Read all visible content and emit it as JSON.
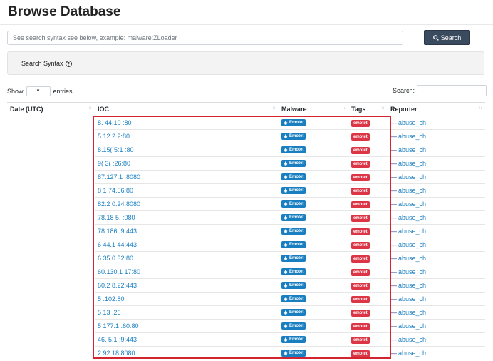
{
  "header": {
    "title": "Browse Database"
  },
  "search": {
    "placeholder": "See search syntax see below, example: malware:ZLoader",
    "button_label": "Search"
  },
  "syntax": {
    "label": "Search Syntax"
  },
  "length": {
    "show_label": "Show",
    "entries_label": "entries"
  },
  "filter": {
    "label": "Search:"
  },
  "table": {
    "columns": [
      "Date (UTC)",
      "IOC",
      "Malware",
      "Tags",
      "Reporter"
    ],
    "rows": [
      {
        "ioc": "8.  44.10     :80",
        "malware": "Emotet",
        "tag": "emotet",
        "reporter": "abuse_ch"
      },
      {
        "ioc": "5.12.2       2:80",
        "malware": "Emotet",
        "tag": "emotet",
        "reporter": "abuse_ch"
      },
      {
        "ioc": "8.15(      5:1  :80",
        "malware": "Emotet",
        "tag": "emotet",
        "reporter": "abuse_ch"
      },
      {
        "ioc": "9(     3(     :26:80",
        "malware": "Emotet",
        "tag": "emotet",
        "reporter": "abuse_ch"
      },
      {
        "ioc": "87.127.1      :8080",
        "malware": "Emotet",
        "tag": "emotet",
        "reporter": "abuse_ch"
      },
      {
        "ioc": "8   1      74.56:80",
        "malware": "Emotet",
        "tag": "emotet",
        "reporter": "abuse_ch"
      },
      {
        "ioc": "82.2       0.24:8080",
        "malware": "Emotet",
        "tag": "emotet",
        "reporter": "abuse_ch"
      },
      {
        "ioc": "78.18      5.   :080",
        "malware": "Emotet",
        "tag": "emotet",
        "reporter": "abuse_ch"
      },
      {
        "ioc": "78.186      :9:443",
        "malware": "Emotet",
        "tag": "emotet",
        "reporter": "abuse_ch"
      },
      {
        "ioc": "6  44.1      44:443",
        "malware": "Emotet",
        "tag": "emotet",
        "reporter": "abuse_ch"
      },
      {
        "ioc": "6   35.0     32:80",
        "malware": "Emotet",
        "tag": "emotet",
        "reporter": "abuse_ch"
      },
      {
        "ioc": "60.130.1      17:80",
        "malware": "Emotet",
        "tag": "emotet",
        "reporter": "abuse_ch"
      },
      {
        "ioc": "60.2       8.22:443",
        "malware": "Emotet",
        "tag": "emotet",
        "reporter": "abuse_ch"
      },
      {
        "ioc": "5       .102:80",
        "malware": "Emotet",
        "tag": "emotet",
        "reporter": "abuse_ch"
      },
      {
        "ioc": "5  13      .26    ",
        "malware": "Emotet",
        "tag": "emotet",
        "reporter": "abuse_ch"
      },
      {
        "ioc": "5   177.1      :60:80",
        "malware": "Emotet",
        "tag": "emotet",
        "reporter": "abuse_ch"
      },
      {
        "ioc": "46.   5.1     :9:443",
        "malware": "Emotet",
        "tag": "emotet",
        "reporter": "abuse_ch"
      },
      {
        "ioc": "2  92.18      8080",
        "malware": "Emotet",
        "tag": "emotet",
        "reporter": "abuse_ch"
      }
    ]
  },
  "colors": {
    "link": "#1a7fc1",
    "tag_badge": "#dc3545",
    "search_button": "#3a4a5f",
    "highlight": "#d32530"
  },
  "icons": {
    "search": "magnifier-icon",
    "help": "question-circle-icon",
    "malware": "bug-icon",
    "reporter": "user-icon"
  }
}
